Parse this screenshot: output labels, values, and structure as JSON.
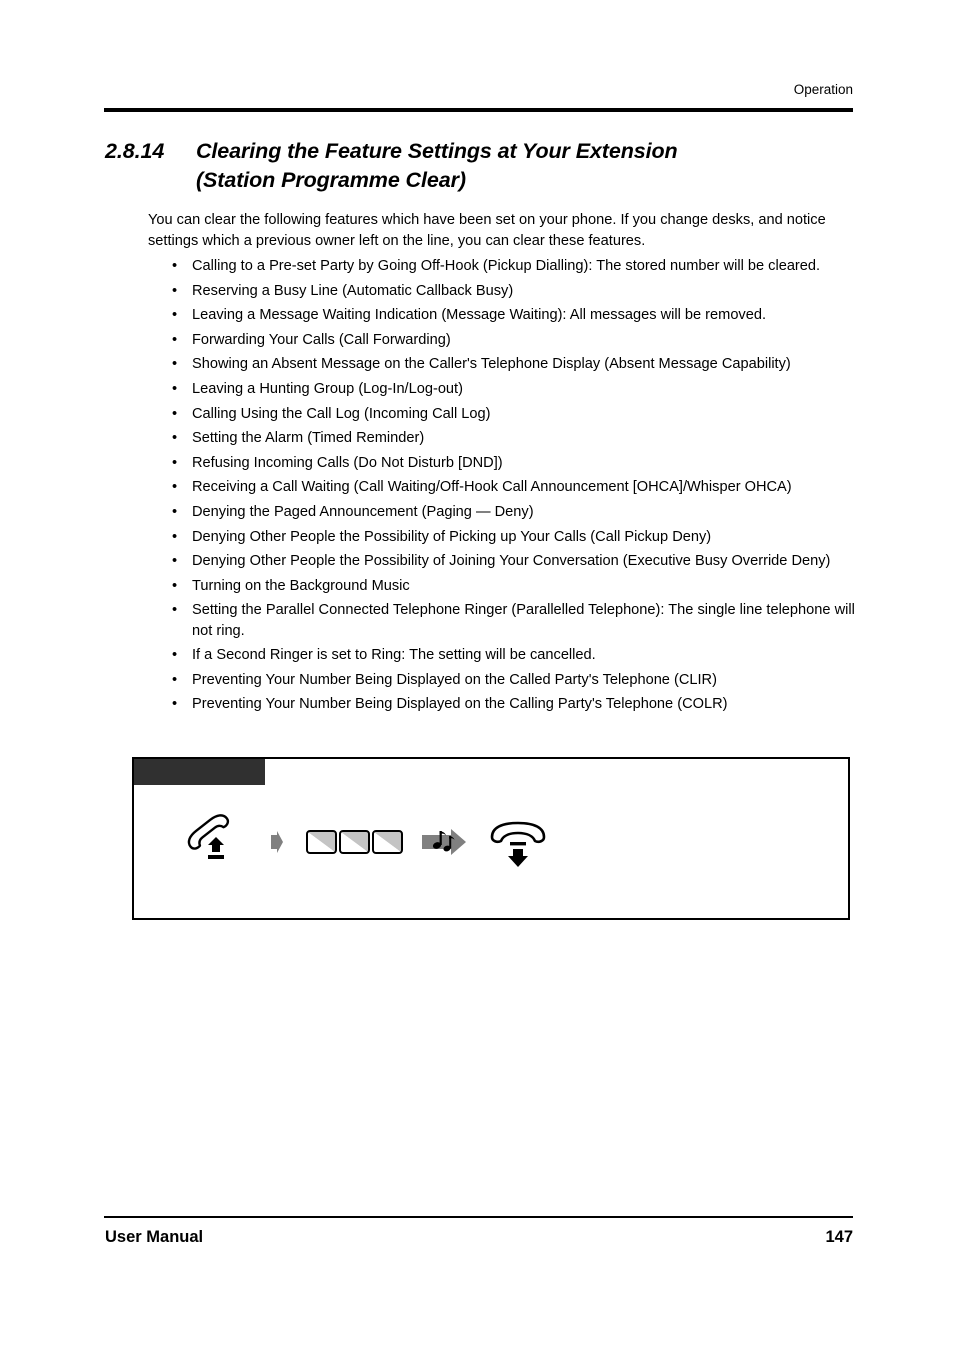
{
  "page": {
    "running_head": "Operation",
    "footer_left": "User Manual",
    "footer_page_number": "147"
  },
  "section": {
    "number": "2.8.14",
    "title_line1": "Clearing the Feature Settings at Your Extension",
    "title_line2": "(Station Programme Clear)"
  },
  "body": {
    "intro": "You can clear the following features which have been set on your phone. If you change desks, and notice settings which a previous owner left on the line, you can clear these features.",
    "bullet_marker": "•",
    "bullets": [
      "Calling to a Pre-set Party by Going Off-Hook (Pickup Dialling): The stored number will be cleared.",
      "Reserving a Busy Line (Automatic Callback Busy)",
      "Leaving a Message Waiting Indication (Message Waiting): All messages will be removed.",
      "Forwarding Your Calls (Call Forwarding)",
      "Showing an Absent Message on the Caller's Telephone Display (Absent Message Capability)",
      "Leaving a Hunting Group (Log-In/Log-out)",
      "Calling Using the Call Log (Incoming Call Log)",
      "Setting the Alarm (Timed Reminder)",
      "Refusing Incoming Calls (Do Not Disturb [DND])",
      "Receiving a Call Waiting (Call Waiting/Off-Hook Call Announcement [OHCA]/Whisper OHCA)",
      "Denying the Paged Announcement (Paging — Deny)",
      "Denying Other People the Possibility of Picking up Your Calls (Call Pickup Deny)",
      "Denying Other People the Possibility of Joining Your Conversation (Executive Busy Override Deny)",
      "Turning on the Background Music",
      "Setting the Parallel Connected Telephone Ringer (Parallelled Telephone): The single line telephone will not ring.",
      "If a Second Ringer is set to Ring: The setting will be cancelled.",
      "Preventing Your Number Being Displayed on the Called Party's Telephone (CLIR)",
      "Preventing Your Number Being Displayed on the Calling Party's Telephone (COLR)"
    ]
  },
  "diagram": {
    "tab_label": "",
    "tab_color": "#303030",
    "key_fill_color": "#c4c4c4",
    "arrow_color": "#808080",
    "steps": [
      {
        "icon": "offhook-handset-icon",
        "label": ""
      },
      {
        "icon": "arrow-right-icon",
        "label": ""
      },
      {
        "icon": "keypad-keys-icon",
        "label": "",
        "key_count": 3
      },
      {
        "icon": "confirmation-tone-arrow-icon",
        "label": ""
      },
      {
        "icon": "onhook-handset-icon",
        "label": ""
      }
    ]
  }
}
